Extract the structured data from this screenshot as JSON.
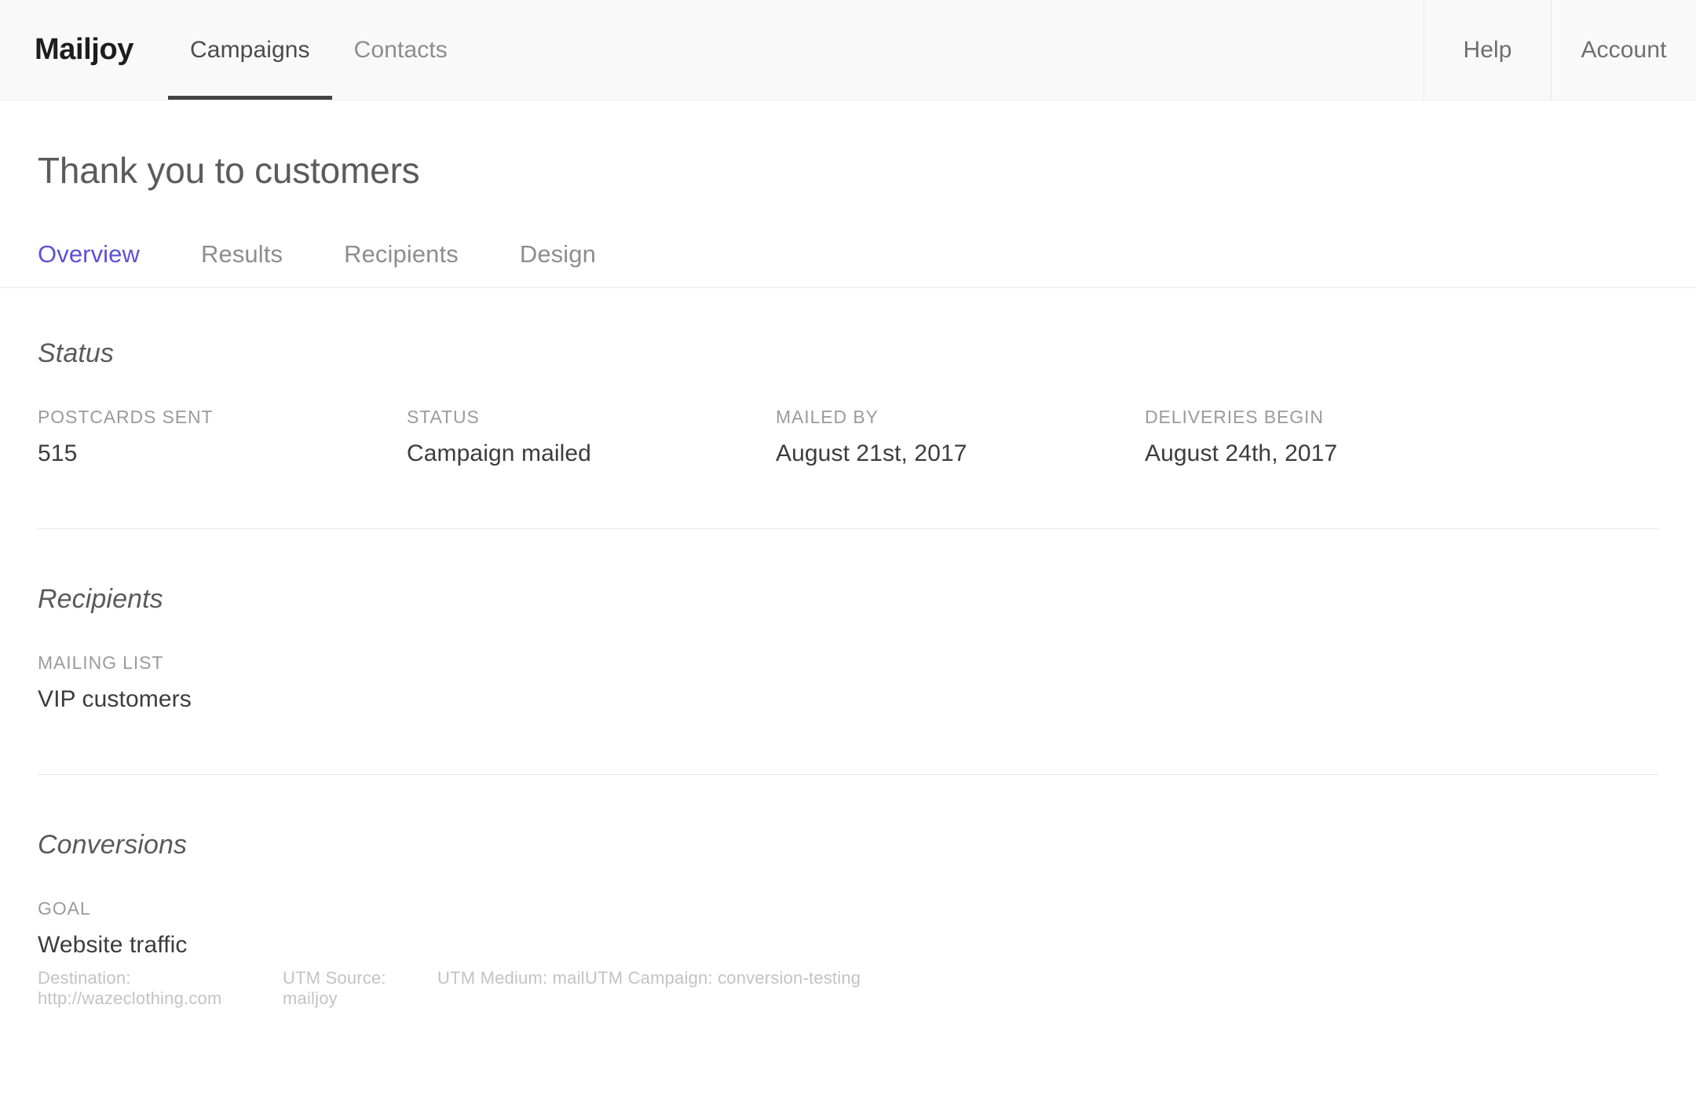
{
  "brand": {
    "name": "Mailjoy"
  },
  "topnav": {
    "primary": [
      {
        "label": "Campaigns",
        "active": true
      },
      {
        "label": "Contacts",
        "active": false
      }
    ],
    "secondary": [
      {
        "label": "Help"
      },
      {
        "label": "Account"
      }
    ]
  },
  "page": {
    "title": "Thank you to customers"
  },
  "subtabs": [
    {
      "label": "Overview",
      "active": true
    },
    {
      "label": "Results",
      "active": false
    },
    {
      "label": "Recipients",
      "active": false
    },
    {
      "label": "Design",
      "active": false
    }
  ],
  "sections": {
    "status": {
      "heading": "Status",
      "fields": [
        {
          "label": "POSTCARDS SENT",
          "value": "515"
        },
        {
          "label": "STATUS",
          "value": "Campaign mailed"
        },
        {
          "label": "MAILED BY",
          "value": "August 21st, 2017"
        },
        {
          "label": "DELIVERIES BEGIN",
          "value": "August 24th, 2017"
        }
      ]
    },
    "recipients": {
      "heading": "Recipients",
      "fields": [
        {
          "label": "MAILING LIST",
          "value": "VIP customers"
        }
      ]
    },
    "conversions": {
      "heading": "Conversions",
      "fields": [
        {
          "label": "GOAL",
          "value": "Website traffic"
        }
      ],
      "utm": [
        "Destination: http://wazeclothing.com",
        "UTM Source: mailjoy",
        "UTM Medium: mail",
        "UTM Campaign: conversion-testing"
      ]
    }
  },
  "colors": {
    "accent": "#5c51d6",
    "nav_bg": "#f9f9f9",
    "text_primary": "#3c3c3c",
    "text_muted": "#9b9b9b",
    "text_faint": "#c3c3c3"
  }
}
